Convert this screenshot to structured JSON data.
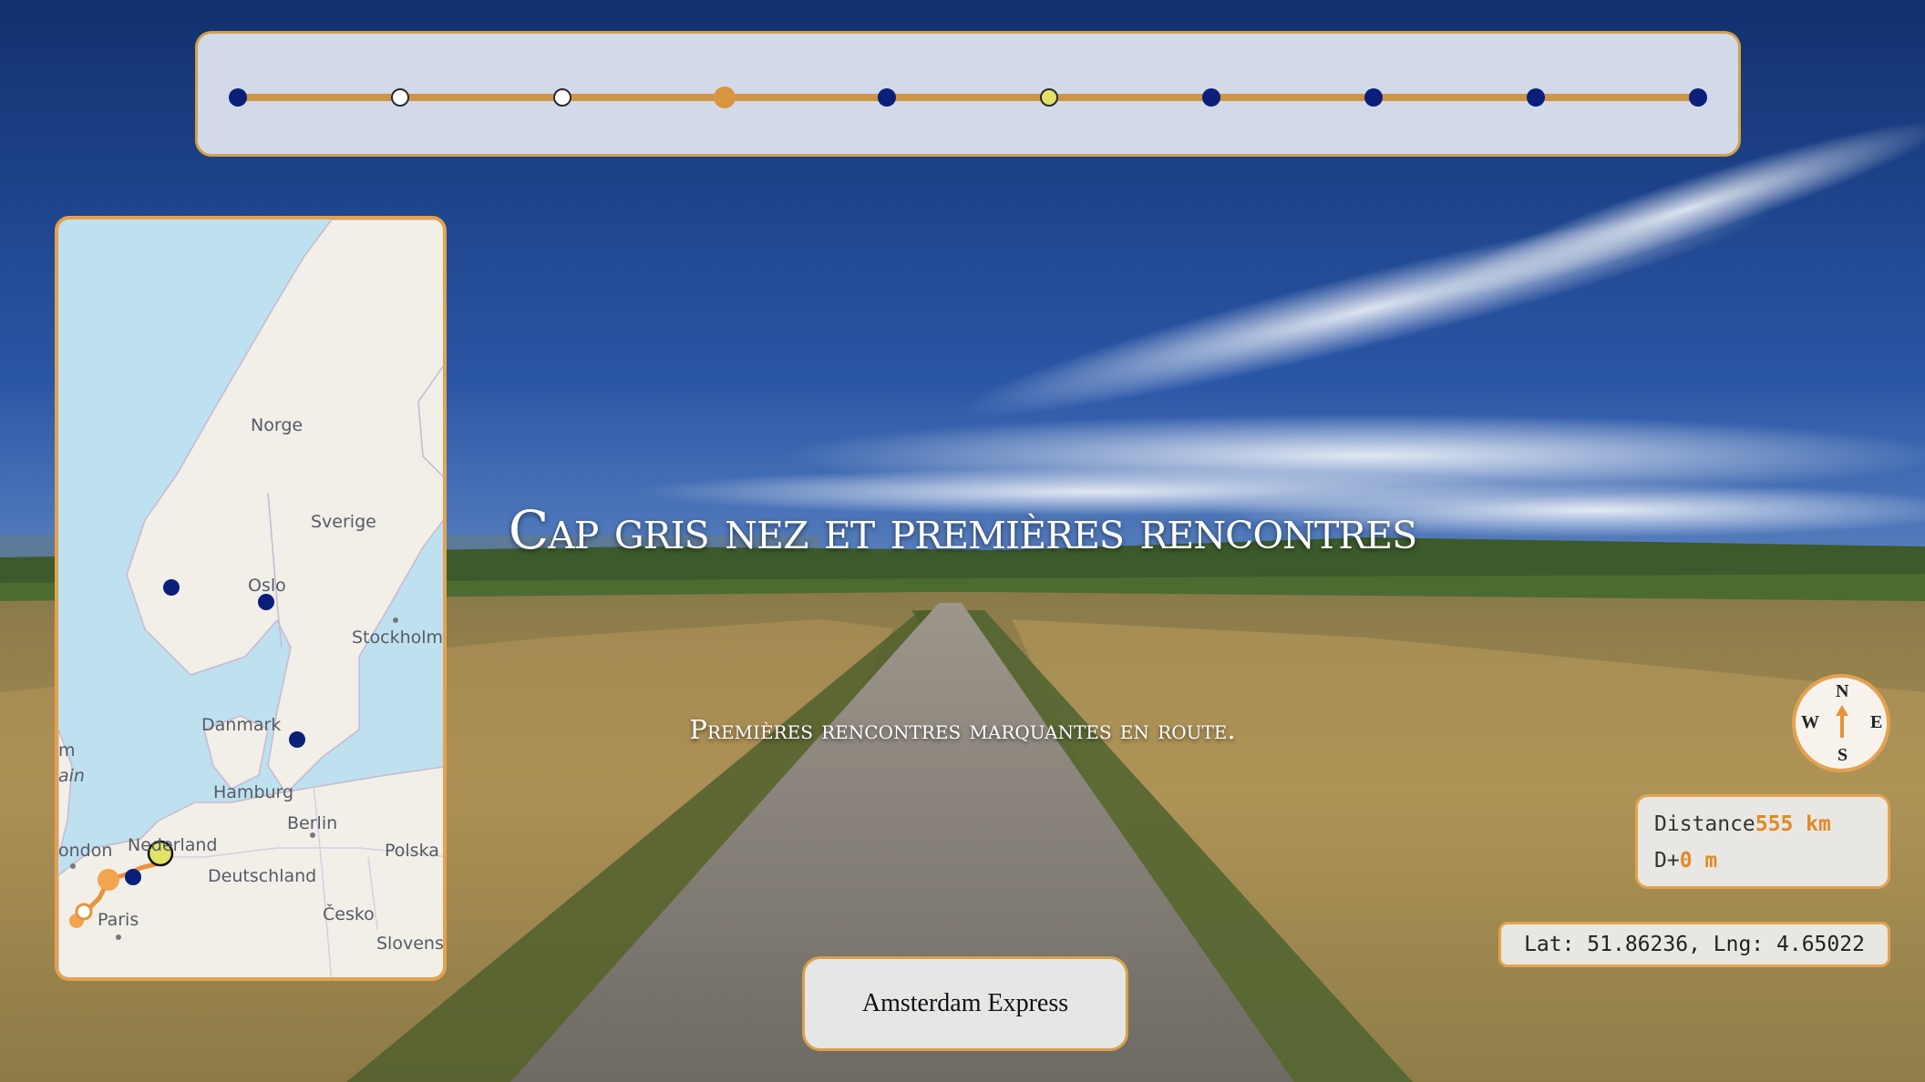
{
  "chapter": {
    "title": "Cap gris nez et premières rencontres",
    "subtitle": "Premières rencontres marquantes en route."
  },
  "timeline": {
    "track_color": "#cf9546",
    "stops": [
      {
        "state": "done"
      },
      {
        "state": "visited"
      },
      {
        "state": "visited"
      },
      {
        "state": "current"
      },
      {
        "state": "done"
      },
      {
        "state": "highlight"
      },
      {
        "state": "done"
      },
      {
        "state": "done"
      },
      {
        "state": "done"
      },
      {
        "state": "done"
      }
    ]
  },
  "minimap": {
    "labels": {
      "norge": "Norge",
      "sverige": "Sverige",
      "oslo": "Oslo",
      "stockholm": "Stockholm",
      "danmark": "Danmark",
      "hamburg": "Hamburg",
      "berlin": "Berlin",
      "polska": "Polska",
      "nederland": "Nederland",
      "london": "ondon",
      "deutschland": "Deutschland",
      "paris": "Paris",
      "cesko": "Česko",
      "slovensko": "Slovens",
      "ain": "ain",
      "m": "m"
    }
  },
  "express_button": {
    "label": "Amsterdam Express"
  },
  "compass": {
    "n": "N",
    "s": "S",
    "e": "E",
    "w": "W",
    "heading": "north-arrow"
  },
  "stats": {
    "distance_label": "Distance",
    "distance_value": "555 km",
    "elevation_label": "D+",
    "elevation_value": "0 m"
  },
  "coords": {
    "text": "Lat: 51.86236, Lng: 4.65022"
  },
  "colors": {
    "accent": "#e3a24f",
    "marker_done": "#0b1f7a",
    "marker_highlight": "#e2e366"
  }
}
